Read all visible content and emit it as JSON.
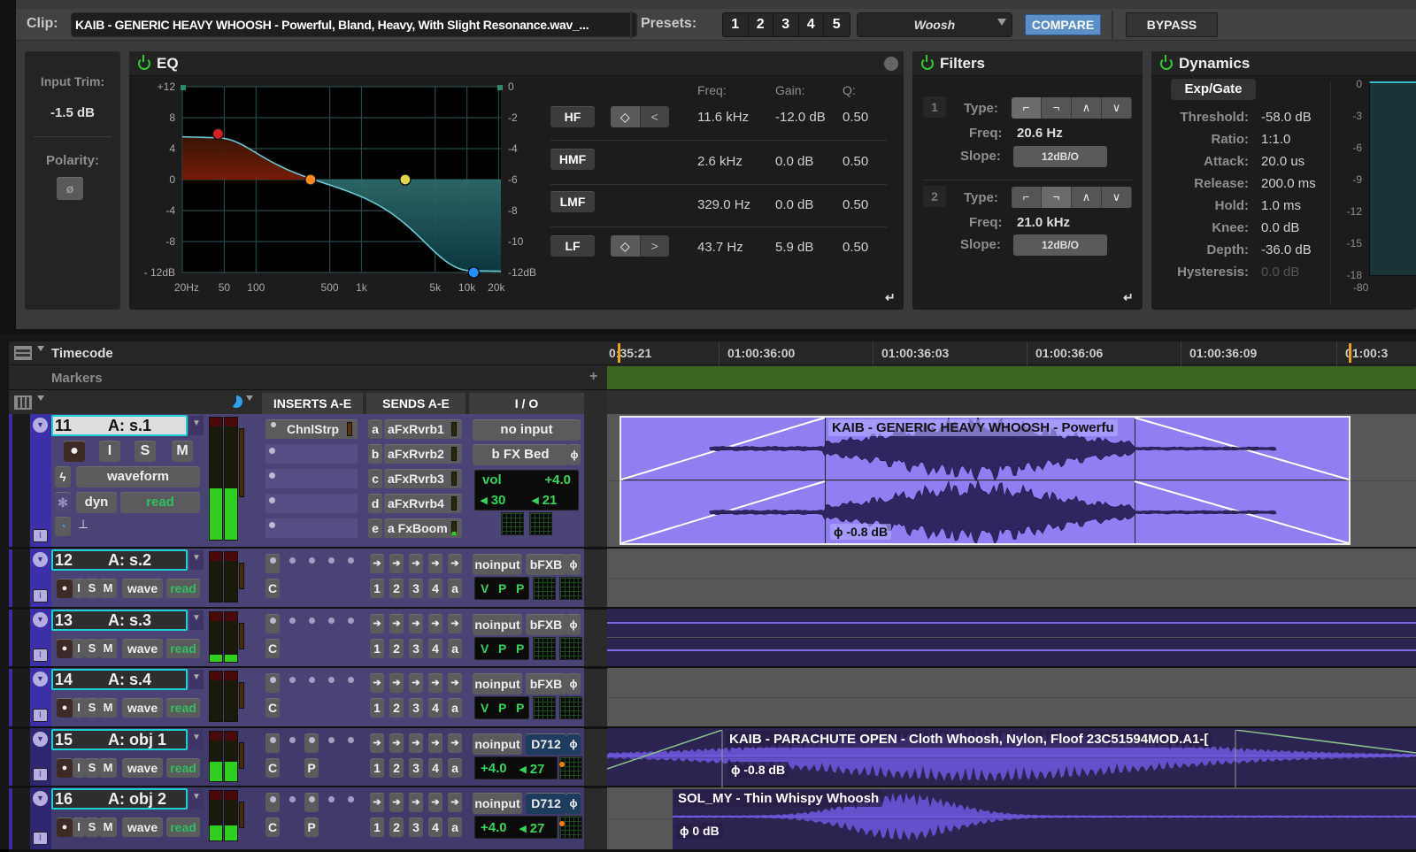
{
  "plugin": {
    "clip_label": "Clip:",
    "clip_name": "KAIB - GENERIC HEAVY WHOOSH - Powerful,  Bland, Heavy, With Slight Resonance.wav_...",
    "presets_label": "Presets:",
    "presets": [
      "1",
      "2",
      "3",
      "4",
      "5"
    ],
    "preset_selected": "Woosh",
    "compare_label": "COMPARE",
    "bypass_label": "BYPASS",
    "compare_color": "#5b8fc6",
    "input": {
      "trim_label": "Input Trim:",
      "trim_value": "-1.5 dB",
      "polarity_label": "Polarity:",
      "polarity_symbol": "ø"
    },
    "eq": {
      "title": "EQ",
      "enabled": true,
      "left_axis": [
        "+12",
        "8",
        "4",
        "0",
        "-4",
        "-8",
        "- 12dB"
      ],
      "right_axis": [
        "0",
        "-2",
        "-4",
        "-6",
        "-8",
        "-10",
        "-12dB"
      ],
      "freq_axis": [
        "20Hz",
        "50",
        "100",
        "500",
        "1k",
        "5k",
        "10k",
        "20k"
      ],
      "col_headers": {
        "freq": "Freq:",
        "gain": "Gain:",
        "q": "Q:"
      },
      "bands": [
        {
          "name": "HF",
          "freq": "11.6 kHz",
          "gain": "-12.0 dB",
          "q": "0.50",
          "shape_buttons": [
            "bell",
            "shelf-high"
          ],
          "node_color": "#1e90ff",
          "freq_hz": 11600,
          "gain_db": -12.0
        },
        {
          "name": "HMF",
          "freq": "2.6 kHz",
          "gain": "0.0 dB",
          "q": "0.50",
          "node_color": "#e0d84a",
          "freq_hz": 2600,
          "gain_db": 0.0
        },
        {
          "name": "LMF",
          "freq": "329.0 Hz",
          "gain": "0.0 dB",
          "q": "0.50",
          "node_color": "#ff8a1a",
          "freq_hz": 329,
          "gain_db": 0.0
        },
        {
          "name": "LF",
          "freq": "43.7 Hz",
          "gain": "5.9 dB",
          "q": "0.50",
          "shape_buttons": [
            "bell",
            "shelf-low"
          ],
          "node_color": "#d42020",
          "freq_hz": 43.7,
          "gain_db": 5.9
        }
      ]
    },
    "filters": {
      "title": "Filters",
      "enabled": true,
      "items": [
        {
          "index": "1",
          "type_label": "Type:",
          "freq_label": "Freq:",
          "freq": "20.6 Hz",
          "slope_label": "Slope:",
          "slope": "12dB/O",
          "selected_type": 0
        },
        {
          "index": "2",
          "type_label": "Type:",
          "freq_label": "Freq:",
          "freq": "21.0 kHz",
          "slope_label": "Slope:",
          "slope": "12dB/O",
          "selected_type": 1
        }
      ],
      "type_glyphs": [
        "⌐",
        "¬",
        "∧",
        "∨"
      ]
    },
    "dynamics": {
      "title": "Dynamics",
      "enabled": true,
      "mode": "Exp/Gate",
      "params": [
        {
          "label": "Threshold:",
          "value": "-58.0 dB"
        },
        {
          "label": "Ratio:",
          "value": "1:1.0"
        },
        {
          "label": "Attack:",
          "value": "20.0 us"
        },
        {
          "label": "Release:",
          "value": "200.0 ms"
        },
        {
          "label": "Hold:",
          "value": "1.0 ms"
        },
        {
          "label": "Knee:",
          "value": "0.0 dB"
        },
        {
          "label": "Depth:",
          "value": "-36.0 dB"
        },
        {
          "label": "Hysteresis:",
          "value": "0.0 dB",
          "disabled": true
        }
      ],
      "meter_scale": [
        "0",
        "-3",
        "-6",
        "-9",
        "-12",
        "-15",
        "-18"
      ],
      "meter_bottom": "-80"
    }
  },
  "edit": {
    "rulers": {
      "timecode": "Timecode",
      "markers": "Markers"
    },
    "column_headers": {
      "inserts": "INSERTS A-E",
      "sends": "SENDS A-E",
      "io": "I / O"
    },
    "timecodes": [
      "0:35:21",
      "01:00:36:00",
      "01:00:36:03",
      "01:00:36:06",
      "01:00:36:09",
      "01:00:3"
    ],
    "tracks": [
      {
        "num": "11",
        "name": "A: s.1",
        "selected": true,
        "view": "waveform",
        "dyn": "dyn",
        "automation": "read",
        "inserts": [
          "ChnlStrp",
          "",
          "",
          "",
          ""
        ],
        "sends": [
          {
            "l": "a",
            "n": "aFxRvrb1"
          },
          {
            "l": "b",
            "n": "aFxRvrb2"
          },
          {
            "l": "c",
            "n": "aFxRvrb3"
          },
          {
            "l": "d",
            "n": "aFxRvrb4"
          },
          {
            "l": "e",
            "n": "a FxBoom"
          }
        ],
        "input": "no input",
        "output": "b FX Bed",
        "vol_label": "vol",
        "vol": "+4.0",
        "pan_l": "30",
        "pan_r": "21",
        "clip": {
          "name": "KAIB - GENERIC HEAVY WHOOSH - Powerfu",
          "gain": "-0.8 dB"
        }
      },
      {
        "num": "12",
        "name": "A: s.2",
        "view": "wave",
        "automation": "read",
        "input": "noinput",
        "output": "bFXB",
        "disp": [
          "V",
          "P",
          "P"
        ]
      },
      {
        "num": "13",
        "name": "A: s.3",
        "view": "wave",
        "automation": "read",
        "input": "noinput",
        "output": "bFXB",
        "disp": [
          "V",
          "P",
          "P"
        ]
      },
      {
        "num": "14",
        "name": "A: s.4",
        "view": "wave",
        "automation": "read",
        "input": "noinput",
        "output": "bFXB",
        "disp": [
          "V",
          "P",
          "P"
        ]
      },
      {
        "num": "15",
        "name": "A: obj 1",
        "view": "wave",
        "automation": "read",
        "input": "noinput",
        "output": "D712",
        "vol": "+4.0",
        "pan": "27",
        "clip": {
          "name": "KAIB - PARACHUTE OPEN - Cloth Whoosh, Nylon, Floof 23C51594MOD.A1-[",
          "gain": "-0.8 dB"
        }
      },
      {
        "num": "16",
        "name": "A: obj 2",
        "view": "wave",
        "automation": "read",
        "input": "noinput",
        "output": "D712",
        "vol": "+4.0",
        "pan": "27",
        "clip": {
          "name": "SOL_MY - Thin Whispy Whoosh",
          "gain": "0 dB"
        }
      }
    ],
    "compact_buttons": {
      "rec": "●",
      "input": "I",
      "solo": "S",
      "mute": "M"
    },
    "send_numbers": [
      "1",
      "2",
      "3",
      "4",
      "a"
    ],
    "insert_c": "C",
    "insert_p": "P"
  }
}
